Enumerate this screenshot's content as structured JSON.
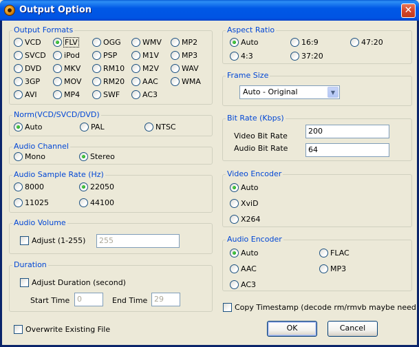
{
  "window": {
    "title": "Output Option",
    "close_glyph": "✕"
  },
  "output_formats": {
    "title": "Output Formats",
    "selected": "FLV",
    "options": [
      "VCD",
      "FLV",
      "OGG",
      "WMV",
      "MP2",
      "SVCD",
      "iPod",
      "PSP",
      "M1V",
      "MP3",
      "DVD",
      "MKV",
      "RM10",
      "M2V",
      "WAV",
      "3GP",
      "MOV",
      "RM20",
      "AAC",
      "WMA",
      "AVI",
      "MP4",
      "SWF",
      "AC3"
    ]
  },
  "norm": {
    "title": "Norm(VCD/SVCD/DVD)",
    "options": [
      "Auto",
      "PAL",
      "NTSC"
    ],
    "selected": "Auto"
  },
  "audio_channel": {
    "title": "Audio Channel",
    "options": [
      "Mono",
      "Stereo"
    ],
    "selected": "Stereo"
  },
  "audio_sample_rate": {
    "title": "Audio Sample Rate (Hz)",
    "options": [
      "8000",
      "22050",
      "11025",
      "44100"
    ],
    "selected": "22050"
  },
  "audio_volume": {
    "title": "Audio Volume",
    "adjust_label": "Adjust (1-255)",
    "value": "255"
  },
  "duration": {
    "title": "Duration",
    "adjust_label": "Adjust Duration (second)",
    "start_label": "Start Time",
    "start_value": "0",
    "end_label": "End Time",
    "end_value": "29"
  },
  "overwrite_label": "Overwrite Existing File",
  "aspect_ratio": {
    "title": "Aspect Ratio",
    "options": [
      "Auto",
      "16:9",
      "47:20",
      "4:3",
      "37:20"
    ],
    "selected": "Auto"
  },
  "frame_size": {
    "title": "Frame Size",
    "selected": "Auto - Original"
  },
  "bit_rate": {
    "title": "Bit Rate (Kbps)",
    "video_label": "Video Bit Rate",
    "video_value": "200",
    "audio_label": "Audio Bit Rate",
    "audio_value": "64"
  },
  "video_encoder": {
    "title": "Video Encoder",
    "options": [
      "Auto",
      "XviD",
      "X264"
    ],
    "selected": "Auto"
  },
  "audio_encoder": {
    "title": "Audio Encoder",
    "options": [
      "Auto",
      "FLAC",
      "AAC",
      "MP3",
      "AC3"
    ],
    "selected": "Auto"
  },
  "copy_timestamp_label": "Copy Timestamp (decode rm/rmvb maybe need this)",
  "buttons": {
    "ok": "OK",
    "cancel": "Cancel"
  }
}
